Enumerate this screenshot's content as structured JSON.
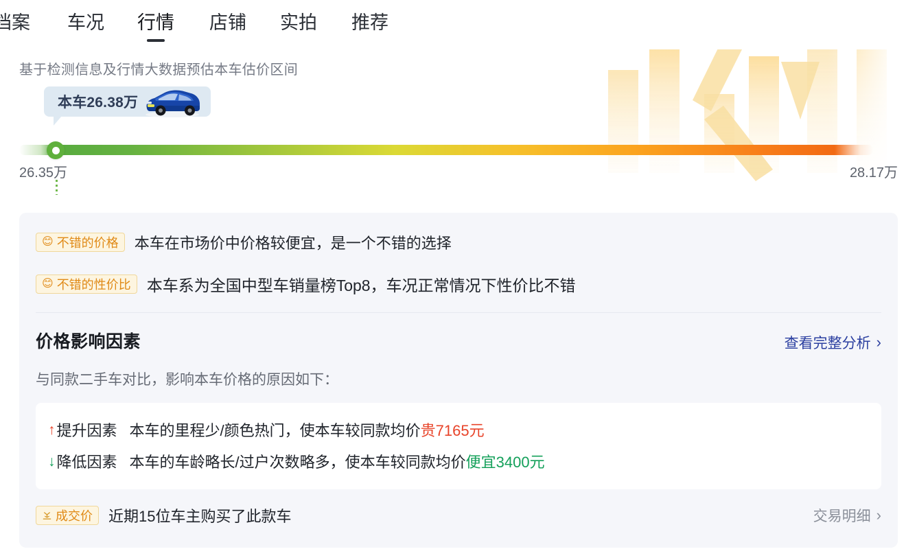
{
  "nav": {
    "tabs": [
      {
        "label": "档案",
        "active": false
      },
      {
        "label": "车况",
        "active": false
      },
      {
        "label": "行情",
        "active": true
      },
      {
        "label": "店铺",
        "active": false
      },
      {
        "label": "实拍",
        "active": false
      },
      {
        "label": "推荐",
        "active": false
      }
    ]
  },
  "hero": {
    "title": "基于检测信息及行情大数据预估本车估价区间",
    "bubble_label": "本车26.38万",
    "range_min": "26.35万",
    "range_max": "28.17万",
    "marker_position_percent": 4,
    "gradient_colors": [
      "#58ab3f",
      "#a9c93b",
      "#f6c02b",
      "#f26a13"
    ],
    "car_icon": "blue-sedan-icon"
  },
  "card": {
    "taglines": [
      {
        "chip": "不错的价格",
        "chip_icon": "smiley-face-icon",
        "desc": "本车在市场价中价格较便宜，是一个不错的选择"
      },
      {
        "chip": "不错的性价比",
        "chip_icon": "smiley-face-icon",
        "desc": "本车系为全国中型车销量榜Top8，车况正常情况下性价比不错"
      }
    ],
    "section": {
      "title": "价格影响因素",
      "link": "查看完整分析",
      "link_chevron": "›",
      "subtitle": "与同款二手车对比，影响本车价格的原因如下："
    },
    "factors": [
      {
        "arrow": "↑",
        "direction": "up",
        "name": "提升因素",
        "desc_prefix": "本车的里程少/颜色热门，使本车较同款均价",
        "amount": "贵7165元"
      },
      {
        "arrow": "↓",
        "direction": "down",
        "name": "降低因素",
        "desc_prefix": "本车的车龄略长/过户次数略多，使本车较同款均价",
        "amount": "便宜3400元"
      }
    ],
    "deal": {
      "chip": "成交价",
      "chip_icon": "handshake-icon",
      "text": "近期15位车主购买了此款车",
      "link": "交易明细",
      "link_chevron": "›"
    }
  }
}
